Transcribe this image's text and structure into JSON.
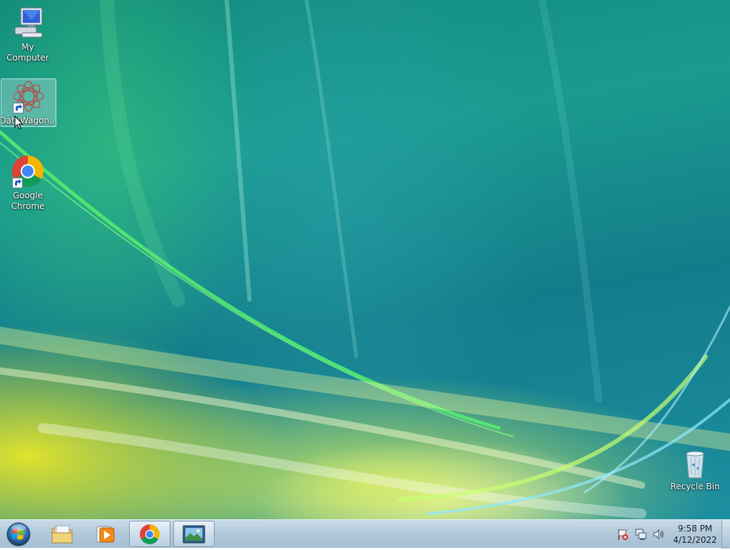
{
  "desktop": {
    "icons": [
      {
        "label": "My Computer",
        "icon": "computer-icon",
        "shortcut": false
      },
      {
        "label": "DataWagon...",
        "icon": "datawagon-icon",
        "shortcut": true,
        "selected": true
      },
      {
        "label": "Google Chrome",
        "icon": "chrome-icon",
        "shortcut": true
      },
      {
        "label": "Recycle Bin",
        "icon": "recycle-bin-icon",
        "shortcut": false
      }
    ]
  },
  "taskbar": {
    "start": {
      "icon": "windows-orb-icon"
    },
    "pinned": [
      {
        "icon": "folder-icon",
        "active": false
      },
      {
        "icon": "media-player-icon",
        "active": false
      },
      {
        "icon": "chrome-icon",
        "active": true
      },
      {
        "icon": "image-viewer-icon",
        "active": true
      }
    ],
    "tray": {
      "icons": [
        "action-center-flag-icon",
        "network-icon",
        "volume-icon"
      ],
      "time": "9:58 PM",
      "date": "4/12/2022"
    }
  },
  "colors": {
    "taskbar": "#b4cadb",
    "wallpaper_teal": "#137c8a",
    "wallpaper_yellow": "#e6e828"
  }
}
